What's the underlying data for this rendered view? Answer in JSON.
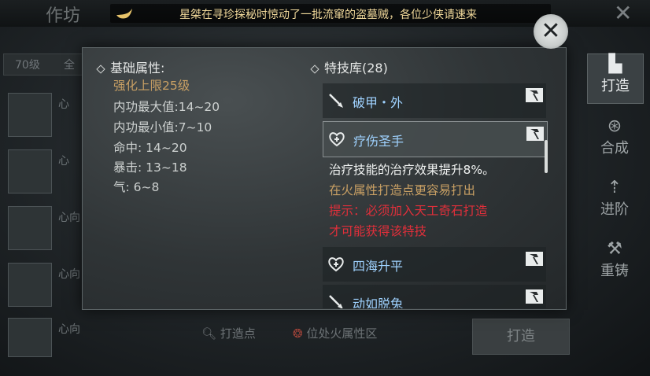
{
  "background": {
    "top_title": "作坊",
    "notice_text": "星桀在寻珍探秘时惊动了一批流窜的盗墓贼，各位少侠请速来",
    "filter_level": "70级",
    "filter_all": "全",
    "list_items": [
      {
        "label": "心"
      },
      {
        "label": "心"
      },
      {
        "label": "心向"
      },
      {
        "label": "心向"
      },
      {
        "label": "心向"
      }
    ],
    "bottom_hint_point": "打造点",
    "bottom_hint_fire": "位处火属性区",
    "forge_button": "打造"
  },
  "tabs": [
    {
      "label": "打造",
      "icon": "anvil-icon",
      "active": true
    },
    {
      "label": "合成",
      "icon": "synthesis-icon",
      "active": false
    },
    {
      "label": "进阶",
      "icon": "upgrade-icon",
      "active": false
    },
    {
      "label": "重铸",
      "icon": "hammer-icon",
      "active": false
    }
  ],
  "popup": {
    "base_title": "基础属性:",
    "enhance_limit": "强化上限25级",
    "attributes": [
      "内功最大值:14~20",
      "内功最小值:7~10",
      "命中: 14~20",
      "暴击: 13~18",
      "气: 6~8"
    ],
    "skill_lib_title": "特技库(28)",
    "skills": [
      {
        "name": "破甲・外",
        "icon": "sword-icon"
      },
      {
        "name": "疗伤圣手",
        "icon": "heal-icon"
      },
      {
        "name": "四海升平",
        "icon": "heal-icon"
      },
      {
        "name": "动如脱兔",
        "icon": "sword-icon"
      }
    ],
    "detail": {
      "line1": "治疗技能的治疗效果提升8%。",
      "line2": "在火属性打造点更容易打出",
      "line3": "提示：必须加入天工奇石打造",
      "line4": "才可能获得该特技"
    },
    "close_icon": "close-icon"
  },
  "colors": {
    "gold": "#c9a064",
    "skill_blue": "#9fd2ff",
    "warning_red": "#e02f3a"
  }
}
